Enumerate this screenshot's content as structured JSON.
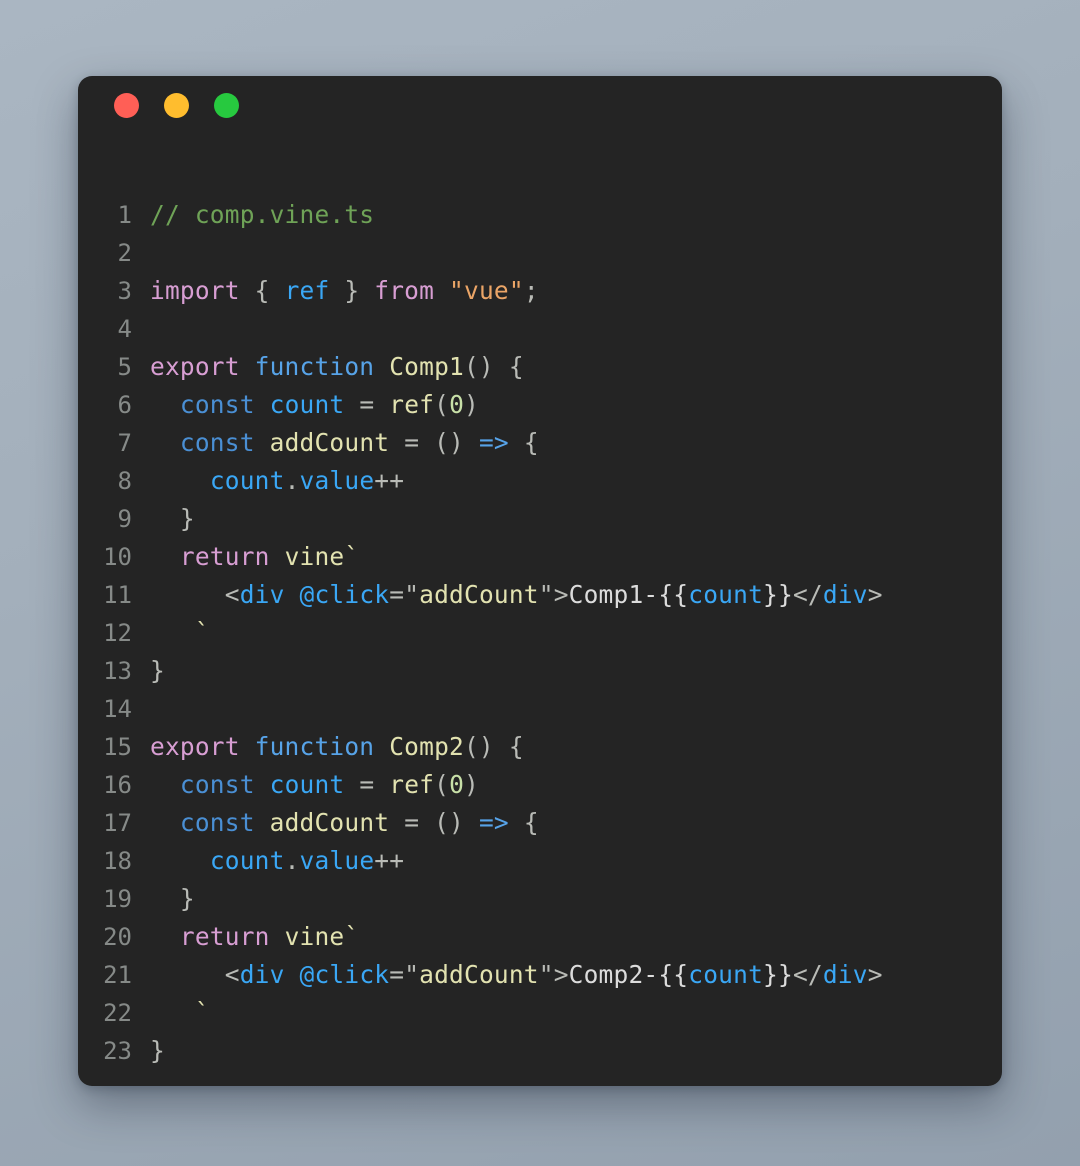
{
  "window": {
    "traffic_lights": [
      {
        "name": "close",
        "color": "#ff5f56"
      },
      {
        "name": "minimize",
        "color": "#ffbd2e"
      },
      {
        "name": "maximize",
        "color": "#27c93f"
      }
    ]
  },
  "editor": {
    "language": "typescript",
    "filename": "comp.vine.ts",
    "line_numbers": [
      "1",
      "2",
      "3",
      "4",
      "5",
      "6",
      "7",
      "8",
      "9",
      "10",
      "11",
      "12",
      "13",
      "14",
      "15",
      "16",
      "17",
      "18",
      "19",
      "20",
      "21",
      "22",
      "23"
    ],
    "lines": [
      {
        "n": "1",
        "tokens": [
          {
            "t": "// comp.vine.ts",
            "c": "t-comment"
          }
        ]
      },
      {
        "n": "2",
        "tokens": []
      },
      {
        "n": "3",
        "tokens": [
          {
            "t": "import",
            "c": "t-keyword"
          },
          {
            "t": " ",
            "c": "t-plain"
          },
          {
            "t": "{",
            "c": "t-punct"
          },
          {
            "t": " ",
            "c": "t-plain"
          },
          {
            "t": "ref",
            "c": "t-var"
          },
          {
            "t": " ",
            "c": "t-plain"
          },
          {
            "t": "}",
            "c": "t-punct"
          },
          {
            "t": " ",
            "c": "t-plain"
          },
          {
            "t": "from",
            "c": "t-keyword"
          },
          {
            "t": " ",
            "c": "t-plain"
          },
          {
            "t": "\"vue\"",
            "c": "t-string"
          },
          {
            "t": ";",
            "c": "t-punct"
          }
        ]
      },
      {
        "n": "4",
        "tokens": []
      },
      {
        "n": "5",
        "tokens": [
          {
            "t": "export",
            "c": "t-keyword"
          },
          {
            "t": " ",
            "c": "t-plain"
          },
          {
            "t": "function",
            "c": "t-func"
          },
          {
            "t": " ",
            "c": "t-plain"
          },
          {
            "t": "Comp1",
            "c": "t-ident"
          },
          {
            "t": "()",
            "c": "t-punct"
          },
          {
            "t": " ",
            "c": "t-plain"
          },
          {
            "t": "{",
            "c": "t-punct"
          }
        ]
      },
      {
        "n": "6",
        "tokens": [
          {
            "t": "  ",
            "c": "t-plain"
          },
          {
            "t": "const",
            "c": "t-const"
          },
          {
            "t": " ",
            "c": "t-plain"
          },
          {
            "t": "count",
            "c": "t-var"
          },
          {
            "t": " ",
            "c": "t-plain"
          },
          {
            "t": "=",
            "c": "t-punct"
          },
          {
            "t": " ",
            "c": "t-plain"
          },
          {
            "t": "ref",
            "c": "t-ident"
          },
          {
            "t": "(",
            "c": "t-punct"
          },
          {
            "t": "0",
            "c": "t-number"
          },
          {
            "t": ")",
            "c": "t-punct"
          }
        ]
      },
      {
        "n": "7",
        "tokens": [
          {
            "t": "  ",
            "c": "t-plain"
          },
          {
            "t": "const",
            "c": "t-const"
          },
          {
            "t": " ",
            "c": "t-plain"
          },
          {
            "t": "addCount",
            "c": "t-ident"
          },
          {
            "t": " ",
            "c": "t-plain"
          },
          {
            "t": "=",
            "c": "t-punct"
          },
          {
            "t": " ",
            "c": "t-plain"
          },
          {
            "t": "()",
            "c": "t-punct"
          },
          {
            "t": " ",
            "c": "t-plain"
          },
          {
            "t": "=>",
            "c": "t-func"
          },
          {
            "t": " ",
            "c": "t-plain"
          },
          {
            "t": "{",
            "c": "t-punct"
          }
        ]
      },
      {
        "n": "8",
        "tokens": [
          {
            "t": "    ",
            "c": "t-plain"
          },
          {
            "t": "count",
            "c": "t-var"
          },
          {
            "t": ".",
            "c": "t-punct"
          },
          {
            "t": "value",
            "c": "t-var"
          },
          {
            "t": "++",
            "c": "t-punct"
          }
        ]
      },
      {
        "n": "9",
        "tokens": [
          {
            "t": "  ",
            "c": "t-plain"
          },
          {
            "t": "}",
            "c": "t-punct"
          }
        ]
      },
      {
        "n": "10",
        "tokens": [
          {
            "t": "  ",
            "c": "t-plain"
          },
          {
            "t": "return",
            "c": "t-keyword"
          },
          {
            "t": " ",
            "c": "t-plain"
          },
          {
            "t": "vine",
            "c": "t-ident"
          },
          {
            "t": "`",
            "c": "t-tick"
          }
        ]
      },
      {
        "n": "11",
        "tokens": [
          {
            "t": "     ",
            "c": "t-plain"
          },
          {
            "t": "<",
            "c": "t-tag"
          },
          {
            "t": "div",
            "c": "t-tagname"
          },
          {
            "t": " ",
            "c": "t-plain"
          },
          {
            "t": "@click",
            "c": "t-attr"
          },
          {
            "t": "=",
            "c": "t-tag"
          },
          {
            "t": "\"",
            "c": "t-tag"
          },
          {
            "t": "addCount",
            "c": "t-attrval"
          },
          {
            "t": "\"",
            "c": "t-tag"
          },
          {
            "t": ">",
            "c": "t-tag"
          },
          {
            "t": "Comp1-",
            "c": "t-plain"
          },
          {
            "t": "{{",
            "c": "t-plain"
          },
          {
            "t": "count",
            "c": "t-var"
          },
          {
            "t": "}}",
            "c": "t-plain"
          },
          {
            "t": "</",
            "c": "t-tag"
          },
          {
            "t": "div",
            "c": "t-tagname"
          },
          {
            "t": ">",
            "c": "t-tag"
          }
        ]
      },
      {
        "n": "12",
        "tokens": [
          {
            "t": "   ",
            "c": "t-plain"
          },
          {
            "t": "`",
            "c": "t-tick"
          }
        ]
      },
      {
        "n": "13",
        "tokens": [
          {
            "t": "}",
            "c": "t-punct"
          }
        ]
      },
      {
        "n": "14",
        "tokens": []
      },
      {
        "n": "15",
        "tokens": [
          {
            "t": "export",
            "c": "t-keyword"
          },
          {
            "t": " ",
            "c": "t-plain"
          },
          {
            "t": "function",
            "c": "t-func"
          },
          {
            "t": " ",
            "c": "t-plain"
          },
          {
            "t": "Comp2",
            "c": "t-ident"
          },
          {
            "t": "()",
            "c": "t-punct"
          },
          {
            "t": " ",
            "c": "t-plain"
          },
          {
            "t": "{",
            "c": "t-punct"
          }
        ]
      },
      {
        "n": "16",
        "tokens": [
          {
            "t": "  ",
            "c": "t-plain"
          },
          {
            "t": "const",
            "c": "t-const"
          },
          {
            "t": " ",
            "c": "t-plain"
          },
          {
            "t": "count",
            "c": "t-var"
          },
          {
            "t": " ",
            "c": "t-plain"
          },
          {
            "t": "=",
            "c": "t-punct"
          },
          {
            "t": " ",
            "c": "t-plain"
          },
          {
            "t": "ref",
            "c": "t-ident"
          },
          {
            "t": "(",
            "c": "t-punct"
          },
          {
            "t": "0",
            "c": "t-number"
          },
          {
            "t": ")",
            "c": "t-punct"
          }
        ]
      },
      {
        "n": "17",
        "tokens": [
          {
            "t": "  ",
            "c": "t-plain"
          },
          {
            "t": "const",
            "c": "t-const"
          },
          {
            "t": " ",
            "c": "t-plain"
          },
          {
            "t": "addCount",
            "c": "t-ident"
          },
          {
            "t": " ",
            "c": "t-plain"
          },
          {
            "t": "=",
            "c": "t-punct"
          },
          {
            "t": " ",
            "c": "t-plain"
          },
          {
            "t": "()",
            "c": "t-punct"
          },
          {
            "t": " ",
            "c": "t-plain"
          },
          {
            "t": "=>",
            "c": "t-func"
          },
          {
            "t": " ",
            "c": "t-plain"
          },
          {
            "t": "{",
            "c": "t-punct"
          }
        ]
      },
      {
        "n": "18",
        "tokens": [
          {
            "t": "    ",
            "c": "t-plain"
          },
          {
            "t": "count",
            "c": "t-var"
          },
          {
            "t": ".",
            "c": "t-punct"
          },
          {
            "t": "value",
            "c": "t-var"
          },
          {
            "t": "++",
            "c": "t-punct"
          }
        ]
      },
      {
        "n": "19",
        "tokens": [
          {
            "t": "  ",
            "c": "t-plain"
          },
          {
            "t": "}",
            "c": "t-punct"
          }
        ]
      },
      {
        "n": "20",
        "tokens": [
          {
            "t": "  ",
            "c": "t-plain"
          },
          {
            "t": "return",
            "c": "t-keyword"
          },
          {
            "t": " ",
            "c": "t-plain"
          },
          {
            "t": "vine",
            "c": "t-ident"
          },
          {
            "t": "`",
            "c": "t-tick"
          }
        ]
      },
      {
        "n": "21",
        "tokens": [
          {
            "t": "     ",
            "c": "t-plain"
          },
          {
            "t": "<",
            "c": "t-tag"
          },
          {
            "t": "div",
            "c": "t-tagname"
          },
          {
            "t": " ",
            "c": "t-plain"
          },
          {
            "t": "@click",
            "c": "t-attr"
          },
          {
            "t": "=",
            "c": "t-tag"
          },
          {
            "t": "\"",
            "c": "t-tag"
          },
          {
            "t": "addCount",
            "c": "t-attrval"
          },
          {
            "t": "\"",
            "c": "t-tag"
          },
          {
            "t": ">",
            "c": "t-tag"
          },
          {
            "t": "Comp2-",
            "c": "t-plain"
          },
          {
            "t": "{{",
            "c": "t-plain"
          },
          {
            "t": "count",
            "c": "t-var"
          },
          {
            "t": "}}",
            "c": "t-plain"
          },
          {
            "t": "</",
            "c": "t-tag"
          },
          {
            "t": "div",
            "c": "t-tagname"
          },
          {
            "t": ">",
            "c": "t-tag"
          }
        ]
      },
      {
        "n": "22",
        "tokens": [
          {
            "t": "   ",
            "c": "t-plain"
          },
          {
            "t": "`",
            "c": "t-tick"
          }
        ]
      },
      {
        "n": "23",
        "tokens": [
          {
            "t": "}",
            "c": "t-punct"
          }
        ]
      }
    ]
  },
  "theme": {
    "background_start": "#aab6c2",
    "background_end": "#93a0ae",
    "window_background": "#242424",
    "gutter_color": "#868a88",
    "text_color": "#d6d6d6",
    "comment_color": "#6fa357",
    "keyword_color": "#d89ed3",
    "function_color": "#57a3e8",
    "variable_color": "#3aa7f5",
    "identifier_color": "#e2e2b0",
    "string_color": "#eba567",
    "number_color": "#c8e0a8",
    "punctuation_color": "#b9bbb6"
  }
}
